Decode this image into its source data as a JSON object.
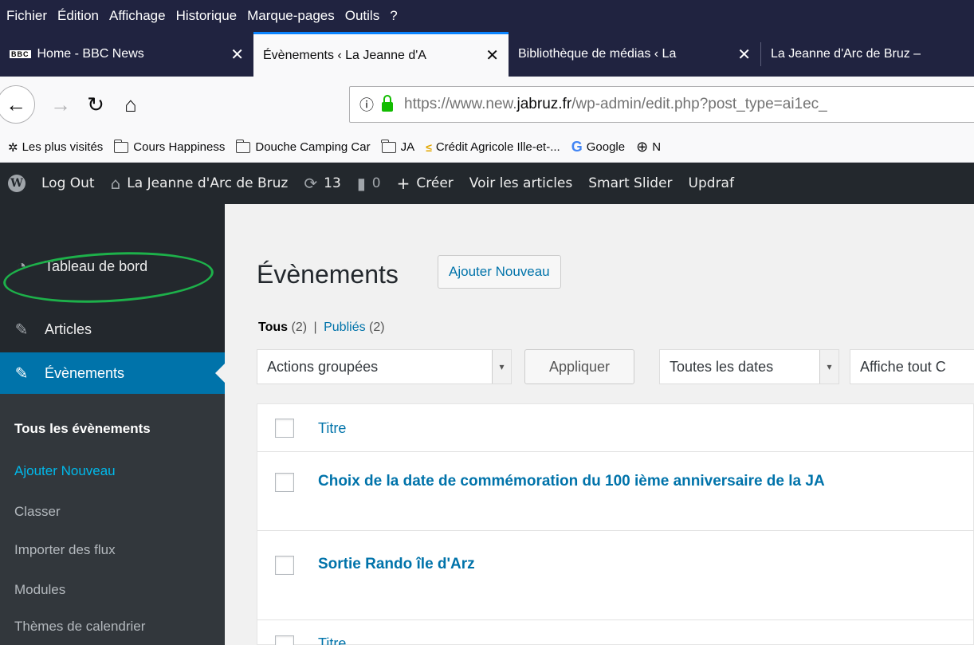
{
  "menubar": {
    "items": [
      "Fichier",
      "Édition",
      "Affichage",
      "Historique",
      "Marque-pages",
      "Outils",
      "?"
    ]
  },
  "tabs": [
    {
      "label": "Home - BBC News",
      "favicon": "BBC"
    },
    {
      "label": "Évènements ‹ La Jeanne d'A"
    },
    {
      "label": "Bibliothèque de médias ‹ La"
    },
    {
      "label": "La Jeanne d'Arc de Bruz –"
    }
  ],
  "url": {
    "prefix": "https://www.new.",
    "domain": "jabruz.fr",
    "path": "/wp-admin/edit.php?post_type=ai1ec_"
  },
  "bookmarks": [
    "Les plus visités",
    "Cours Happiness",
    "Douche Camping Car",
    "JA",
    "Crédit Agricole Ille-et-...",
    "Google",
    "N"
  ],
  "adminbar": {
    "logout": "Log Out",
    "site": "La Jeanne d'Arc de Bruz",
    "updates": "13",
    "comments": "0",
    "create": "Créer",
    "view_posts": "Voir les articles",
    "smart_slider": "Smart Slider",
    "updraft": "Updraf"
  },
  "sidebar": {
    "dashboard": "Tableau de bord",
    "articles": "Articles",
    "events": "Évènements",
    "sub": [
      "Tous les évènements",
      "Ajouter Nouveau",
      "Classer",
      "Importer des flux",
      "Modules",
      "Thèmes de calendrier"
    ]
  },
  "main": {
    "title": "Évènements",
    "add_new": "Ajouter Nouveau",
    "filters": {
      "all": "Tous",
      "all_count": "(2)",
      "separator": "|",
      "published": "Publiés",
      "published_count": "(2)"
    },
    "bulk_actions": "Actions groupées",
    "apply": "Appliquer",
    "all_dates": "Toutes les dates",
    "show_all": "Affiche tout C",
    "column_title": "Titre",
    "rows": [
      "Choix de la date de commémoration du 100 ième anniversaire de la JA",
      "Sortie Rando île d'Arz"
    ],
    "footer_title": "Titre"
  },
  "colors": {
    "firefox_chrome": "#202340",
    "wp_admin": "#23282d",
    "wp_blue": "#0073aa",
    "annotation": "#1db14a"
  }
}
